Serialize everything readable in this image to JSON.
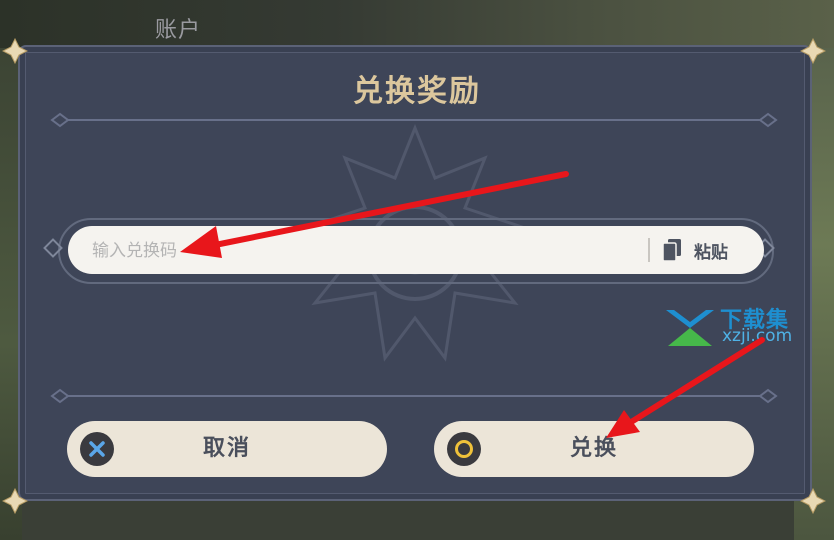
{
  "background": {
    "account_label": "账户"
  },
  "dialog": {
    "title": "兑换奖励",
    "input": {
      "placeholder": "输入兑换码",
      "value": ""
    },
    "paste_label": "粘贴",
    "cancel_label": "取消",
    "confirm_label": "兑换"
  },
  "watermark": {
    "cn": "下载集",
    "en": "xzji.com"
  },
  "colors": {
    "dialog_bg": "#3e4558",
    "title_gold": "#dcc79d",
    "button_bg": "#ece5d8",
    "annotation_arrow": "#e8161b",
    "watermark_blue": "#1e8fd0"
  },
  "icons": {
    "paste": "clipboard-icon",
    "cancel": "x-circle-icon",
    "confirm": "o-circle-icon",
    "corners": "ornament-corner-icon"
  }
}
